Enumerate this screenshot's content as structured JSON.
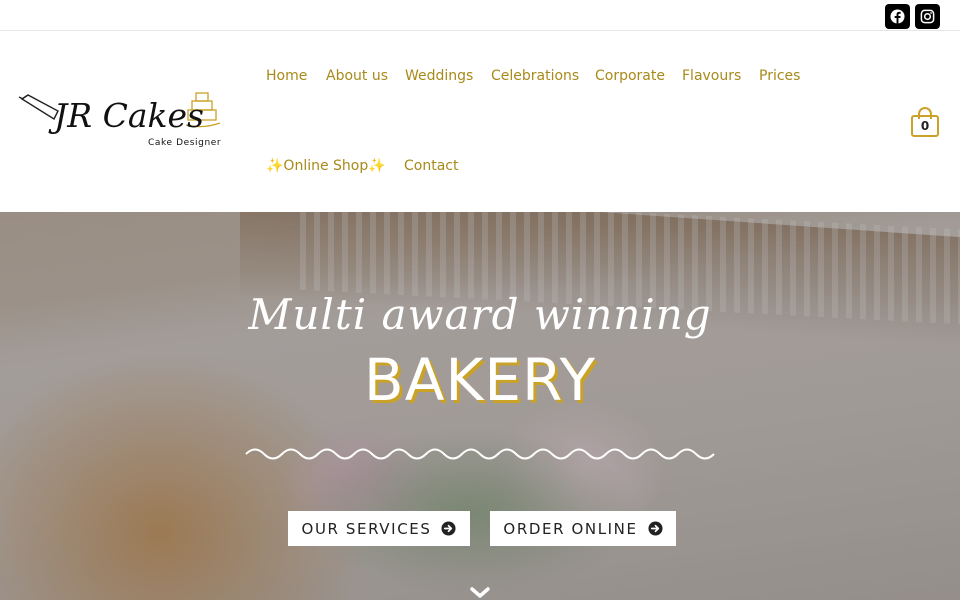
{
  "topbar": {
    "social": [
      {
        "name": "facebook-icon"
      },
      {
        "name": "instagram-icon"
      }
    ]
  },
  "header": {
    "logo": {
      "main": "JR Cakes",
      "sub": "Cake Designer"
    },
    "nav": [
      {
        "label": "Home"
      },
      {
        "label": "About us"
      },
      {
        "label": "Weddings"
      },
      {
        "label": "Celebrations"
      },
      {
        "label": "Corporate"
      },
      {
        "label": "Flavours"
      },
      {
        "label": "Prices"
      },
      {
        "label": "✨Online Shop✨"
      },
      {
        "label": "Contact"
      }
    ],
    "cart_count": "0"
  },
  "hero": {
    "script_title": "Multi award winning",
    "big_title": "BAKERY",
    "buttons": [
      {
        "label": "OUR SERVICES",
        "icon": "arrow-circle-right-icon"
      },
      {
        "label": "ORDER ONLINE",
        "icon": "arrow-circle-right-icon"
      }
    ],
    "scroll_icon": "chevron-down-icon"
  },
  "colors": {
    "accent": "#c9a227",
    "nav_text": "#a88a1a"
  }
}
